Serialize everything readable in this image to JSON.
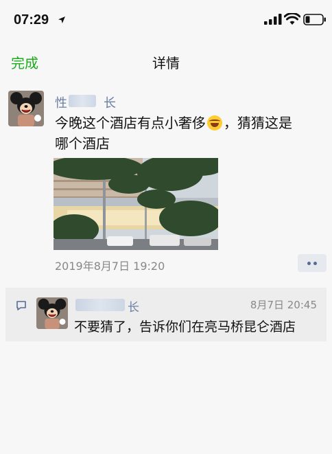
{
  "status": {
    "time": "07:29"
  },
  "nav": {
    "done_label": "完成",
    "title": "详情"
  },
  "post": {
    "nickname_start": "性",
    "nickname_end": "长",
    "text_line1": "今晚这个酒店有点小奢侈",
    "text_line1_after": "，猜猜这是",
    "text_line2": "哪个酒店",
    "timestamp": "2019年8月7日 19:20"
  },
  "comment": {
    "nickname_end": "长",
    "time": "8月7日 20:45",
    "text": "不要猜了，告诉你们在亮马桥昆仑酒店"
  },
  "colors": {
    "accent": "#1aad19",
    "link": "#576b95",
    "nickname": "#6a7fa5"
  },
  "icons": [
    "location-arrow-icon",
    "cellular-signal-icon",
    "wifi-icon",
    "battery-icon",
    "more-dots-icon",
    "comment-icon",
    "laughing-emoji-icon"
  ]
}
